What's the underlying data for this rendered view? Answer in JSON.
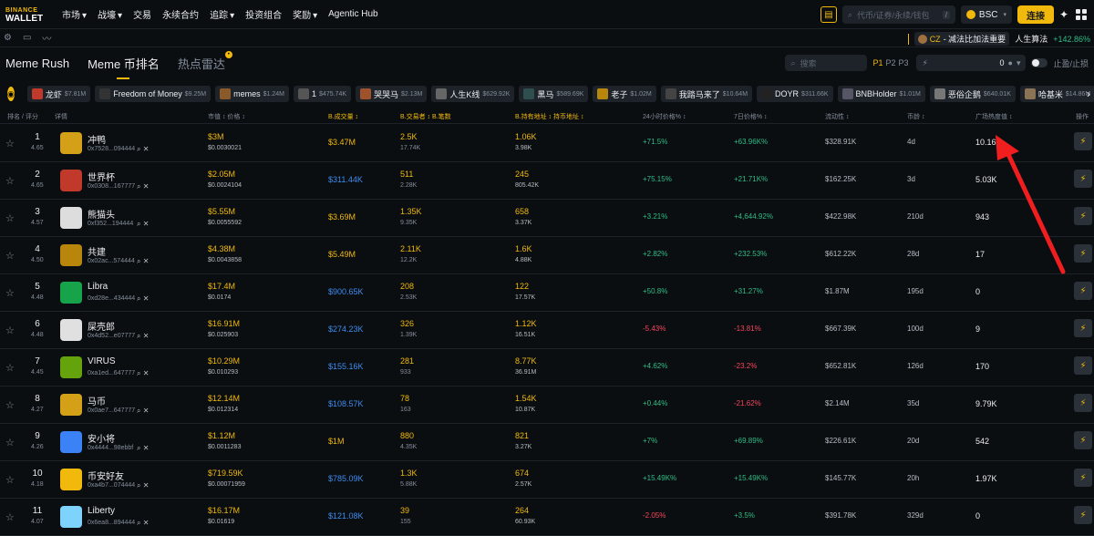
{
  "logo": {
    "line1": "BINANCE",
    "line2": "WALLET"
  },
  "nav": [
    {
      "label": "市场",
      "caret": true,
      "active": false
    },
    {
      "label": "战壕",
      "caret": true,
      "active": true
    },
    {
      "label": "交易",
      "caret": false,
      "active": false
    },
    {
      "label": "永续合约",
      "caret": false,
      "active": false
    },
    {
      "label": "追踪",
      "caret": true,
      "active": false
    },
    {
      "label": "投资组合",
      "caret": false,
      "active": false
    },
    {
      "label": "奖励",
      "caret": true,
      "active": false
    },
    {
      "label": "Agentic Hub",
      "caret": false,
      "active": false
    }
  ],
  "search_top": {
    "placeholder": "代币/证券/永续/钱包",
    "shortcut": "/"
  },
  "chain": {
    "label": "BSC"
  },
  "connect_label": "连接",
  "ticker": {
    "name": "CZ",
    "text": "- 减法比加法重要",
    "item2": "人生算法",
    "item2_change": "+142.86%"
  },
  "tabs": [
    {
      "label": "Meme Rush"
    },
    {
      "label": "Meme 币排名"
    },
    {
      "label": "热点雷达"
    }
  ],
  "tab_right": {
    "search_placeholder": "搜索",
    "pages": [
      "P1",
      "P2",
      "P3"
    ],
    "filter_value": "0",
    "toggle_label": "止盈/止损"
  },
  "tags": [
    {
      "name": "龙虾",
      "val": "$7.81M"
    },
    {
      "name": "Freedom of Money",
      "val": "$9.25M"
    },
    {
      "name": "memes",
      "val": "$1.24M"
    },
    {
      "name": "1",
      "val": "$475.74K"
    },
    {
      "name": "哭哭马",
      "val": "$2.13M"
    },
    {
      "name": "人生K线",
      "val": "$629.92K"
    },
    {
      "name": "黑马",
      "val": "$589.69K"
    },
    {
      "name": "老子",
      "val": "$1.02M"
    },
    {
      "name": "我踏马来了",
      "val": "$10.64M"
    },
    {
      "name": "DOYR",
      "val": "$311.66K"
    },
    {
      "name": "BNBHolder",
      "val": "$1.01M"
    },
    {
      "name": "恶俗企鹅",
      "val": "$640.01K"
    },
    {
      "name": "哈基米",
      "val": "$14.86M"
    }
  ],
  "headers": {
    "rank": "排名 / 评分",
    "detail": "详情",
    "mc": "市值 ↕ 价格 ↕",
    "vol": "B.成交量 ↕",
    "tx": "B.交易者 ↕ B.笔数",
    "hold": "B.持有地址 ↕ 持币地址 ↕",
    "c24": "24小时价格% ↕",
    "c7d": "7日价格% ↕",
    "liq": "流动性 ↕",
    "age": "币龄 ↕",
    "heat": "广场热度值 ↕",
    "op": "操作"
  },
  "rows": [
    {
      "rank": "1",
      "score": "4.65",
      "name": "冲鸭",
      "addr": "0x7528...094444",
      "mc": "$3M",
      "price": "$0.0030021",
      "vol": "$3.47M",
      "tx1": "2.5K",
      "tx2": "17.74K",
      "h1": "1.06K",
      "h2": "3.98K",
      "c24": "+71.5%",
      "c7d": "+63.96K%",
      "liq": "$328.91K",
      "age": "4d",
      "heat": "10.16K",
      "color": "#d4a017"
    },
    {
      "rank": "2",
      "score": "4.65",
      "name": "世界杯",
      "addr": "0x0308...167777",
      "mc": "$2.05M",
      "price": "$0.0024104",
      "vol": "$311.44K",
      "tx1": "511",
      "tx2": "2.28K",
      "h1": "245",
      "h2": "805.42K",
      "c24": "+75.15%",
      "c7d": "+21.71K%",
      "liq": "$162.25K",
      "age": "3d",
      "heat": "5.03K",
      "color": "#c0392b"
    },
    {
      "rank": "3",
      "score": "4.57",
      "name": "熊猫头",
      "addr": "0xf352...194444",
      "mc": "$5.55M",
      "price": "$0.0055592",
      "vol": "$3.69M",
      "tx1": "1.35K",
      "tx2": "9.35K",
      "h1": "658",
      "h2": "3.37K",
      "c24": "+3.21%",
      "c7d": "+4,644.92%",
      "liq": "$422.98K",
      "age": "210d",
      "heat": "943",
      "color": "#dddddd"
    },
    {
      "rank": "4",
      "score": "4.50",
      "name": "共建",
      "addr": "0x02ac...574444",
      "mc": "$4.38M",
      "price": "$0.0043858",
      "vol": "$5.49M",
      "tx1": "2.11K",
      "tx2": "12.2K",
      "h1": "1.6K",
      "h2": "4.88K",
      "c24": "+2.82%",
      "c7d": "+232.53%",
      "liq": "$612.22K",
      "age": "28d",
      "heat": "17",
      "color": "#b8860b"
    },
    {
      "rank": "5",
      "score": "4.48",
      "name": "Libra",
      "addr": "0xd28e...434444",
      "mc": "$17.4M",
      "price": "$0.0174",
      "vol": "$900.65K",
      "tx1": "208",
      "tx2": "2.53K",
      "h1": "122",
      "h2": "17.57K",
      "c24": "+50.8%",
      "c7d": "+31.27%",
      "liq": "$1.87M",
      "age": "195d",
      "heat": "0",
      "color": "#16a34a"
    },
    {
      "rank": "6",
      "score": "4.48",
      "name": "屎壳郎",
      "addr": "0x4d52...e07777",
      "mc": "$16.91M",
      "price": "$0.025903",
      "vol": "$274.23K",
      "tx1": "326",
      "tx2": "1.39K",
      "h1": "1.12K",
      "h2": "16.51K",
      "c24": "-5.43%",
      "c7d": "-13.81%",
      "liq": "$667.39K",
      "age": "100d",
      "heat": "9",
      "color": "#e0e0e0"
    },
    {
      "rank": "7",
      "score": "4.45",
      "name": "VIRUS",
      "addr": "0xa1ed...647777",
      "mc": "$10.29M",
      "price": "$0.010293",
      "vol": "$155.16K",
      "tx1": "281",
      "tx2": "933",
      "h1": "8.77K",
      "h2": "36.91M",
      "c24": "+4.62%",
      "c7d": "-23.2%",
      "liq": "$652.81K",
      "age": "126d",
      "heat": "170",
      "color": "#65a30d"
    },
    {
      "rank": "8",
      "score": "4.27",
      "name": "马币",
      "addr": "0x0ae7...647777",
      "mc": "$12.14M",
      "price": "$0.012314",
      "vol": "$108.57K",
      "tx1": "78",
      "tx2": "163",
      "h1": "1.54K",
      "h2": "10.87K",
      "c24": "+0.44%",
      "c7d": "-21.62%",
      "liq": "$2.14M",
      "age": "35d",
      "heat": "9.79K",
      "color": "#d4a017"
    },
    {
      "rank": "9",
      "score": "4.26",
      "name": "安小将",
      "addr": "0x4444...98ebbf",
      "mc": "$1.12M",
      "price": "$0.0011283",
      "vol": "$1M",
      "tx1": "880",
      "tx2": "4.35K",
      "h1": "821",
      "h2": "3.27K",
      "c24": "+7%",
      "c7d": "+69.89%",
      "liq": "$226.61K",
      "age": "20d",
      "heat": "542",
      "color": "#3b82f6"
    },
    {
      "rank": "10",
      "score": "4.18",
      "name": "币安好友",
      "addr": "0xa4b7...074444",
      "mc": "$719.59K",
      "price": "$0.00071959",
      "vol": "$785.09K",
      "tx1": "1.3K",
      "tx2": "5.88K",
      "h1": "674",
      "h2": "2.57K",
      "c24": "+15.49K%",
      "c7d": "+15.49K%",
      "liq": "$145.77K",
      "age": "20h",
      "heat": "1.97K",
      "color": "#f0b90b"
    },
    {
      "rank": "11",
      "score": "4.07",
      "name": "Liberty",
      "addr": "0x6ea8...894444",
      "mc": "$16.17M",
      "price": "$0.01619",
      "vol": "$121.08K",
      "tx1": "39",
      "tx2": "155",
      "h1": "264",
      "h2": "60.93K",
      "c24": "-2.05%",
      "c7d": "+3.5%",
      "liq": "$391.78K",
      "age": "329d",
      "heat": "0",
      "color": "#7dd3fc"
    }
  ]
}
